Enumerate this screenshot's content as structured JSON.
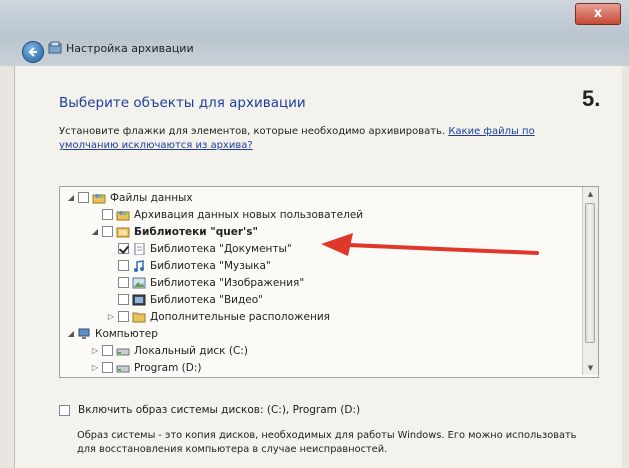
{
  "window": {
    "title": "Настройка архивации",
    "close_label": "x"
  },
  "page": {
    "heading": "Выберите объекты для архивации",
    "step_label": "5.",
    "instruction_text": "Установите флажки для элементов, которые необходимо архивировать.",
    "instruction_link": "Какие файлы по умолчанию исключаются из архива?"
  },
  "tree": {
    "items": [
      {
        "label": "Файлы данных",
        "checked": false,
        "icon": "users-folder-icon"
      },
      {
        "label": "Архивация данных новых пользователей",
        "checked": false,
        "icon": "users-folder-icon"
      },
      {
        "label": "Библиотеки \"quer's\"",
        "checked": false,
        "icon": "library-icon"
      },
      {
        "label": "Библиотека \"Документы\"",
        "checked": true,
        "icon": "documents-icon"
      },
      {
        "label": "Библиотека \"Музыка\"",
        "checked": false,
        "icon": "music-icon"
      },
      {
        "label": "Библиотека \"Изображения\"",
        "checked": false,
        "icon": "pictures-icon"
      },
      {
        "label": "Библиотека \"Видео\"",
        "checked": false,
        "icon": "video-icon"
      },
      {
        "label": "Дополнительные расположения",
        "checked": false,
        "icon": "folder-icon"
      },
      {
        "label": "Компьютер",
        "checked": false,
        "icon": "computer-icon"
      },
      {
        "label": "Локальный диск (C:)",
        "checked": false,
        "icon": "drive-icon"
      },
      {
        "label": "Program (D:)",
        "checked": false,
        "icon": "drive-icon"
      }
    ]
  },
  "system_image": {
    "checkbox_label": "Включить образ системы дисков: (C:), Program (D:)",
    "checked": false,
    "description": "Образ системы - это копия дисков, необходимых для работы Windows. Его можно использовать для восстановления компьютера в случае неисправностей."
  },
  "colors": {
    "heading": "#1d3f9c",
    "annotation_arrow": "#e0372b"
  }
}
